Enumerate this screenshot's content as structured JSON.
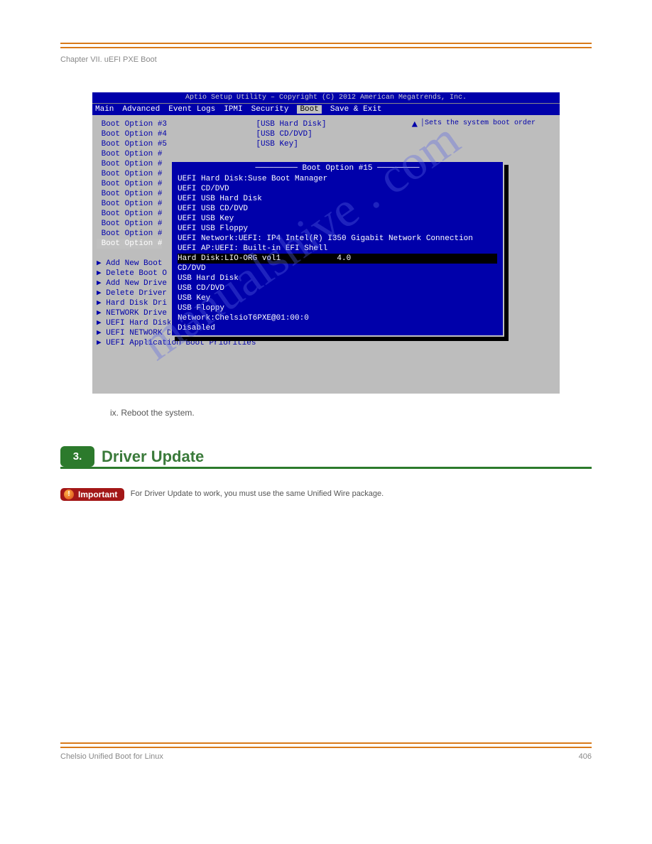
{
  "header": {
    "left": "Chapter VII. uEFI PXE Boot",
    "right": ""
  },
  "bios": {
    "title": "Aptio Setup Utility – Copyright (C) 2012 American Megatrends, Inc.",
    "menu": [
      "Main",
      "Advanced",
      "Event Logs",
      "IPMI",
      "Security",
      "Boot",
      "Save & Exit"
    ],
    "active_menu": "Boot",
    "help": "Sets the system boot order",
    "left_options": [
      {
        "label": "Boot Option #3",
        "value": "[USB Hard Disk]"
      },
      {
        "label": "Boot Option #4",
        "value": "[USB CD/DVD]"
      },
      {
        "label": "Boot Option #5",
        "value": "[USB Key]"
      },
      {
        "label": "Boot Option #",
        "value": ""
      },
      {
        "label": "Boot Option #",
        "value": ""
      },
      {
        "label": "Boot Option #",
        "value": ""
      },
      {
        "label": "Boot Option #",
        "value": ""
      },
      {
        "label": "Boot Option #",
        "value": ""
      },
      {
        "label": "Boot Option #",
        "value": ""
      },
      {
        "label": "Boot Option #",
        "value": ""
      },
      {
        "label": "Boot Option #",
        "value": ""
      },
      {
        "label": "Boot Option #",
        "value": ""
      },
      {
        "label": "Boot Option #",
        "value": ""
      }
    ],
    "left_extra": [
      "▶ Add New Boot",
      "▶ Delete Boot O",
      "",
      "▶ Add New Drive",
      "▶ Delete Driver",
      "",
      "▶ Hard Disk Dri",
      "▶ NETWORK Drive B",
      "▶ UEFI Hard Disk Drive BBS Priorities",
      "▶ UEFI NETWORK Drive BBS Priorities",
      "▶ UEFI Application Boot Priorities"
    ],
    "popup_title": "Boot Option #15",
    "popup_items": [
      "UEFI Hard Disk:Suse Boot Manager",
      "UEFI CD/DVD",
      "UEFI USB Hard Disk",
      "UEFI USB CD/DVD",
      "UEFI USB Key",
      "UEFI USB Floppy",
      "UEFI Network:UEFI: IP4 Intel(R) I350 Gigabit Network Connection",
      "UEFI AP:UEFI: Built-in EFI Shell",
      "Hard Disk:LIO-ORG vol1            4.0",
      "CD/DVD",
      "USB Hard Disk",
      "USB CD/DVD",
      "USB Key",
      "USB Floppy",
      "Network:ChelsioT6PXE@01:00:0",
      "Disabled"
    ],
    "popup_selected_index": 8
  },
  "caption": "ix. Reboot the system.",
  "section": {
    "number": "3.",
    "title": "Driver Update"
  },
  "warning": {
    "label": "Important",
    "text": "For Driver Update to work, you must use the same Unified Wire package."
  },
  "footer": {
    "left": "Chelsio Unified Boot for Linux",
    "right": "406"
  },
  "watermark": "manualshive . com"
}
